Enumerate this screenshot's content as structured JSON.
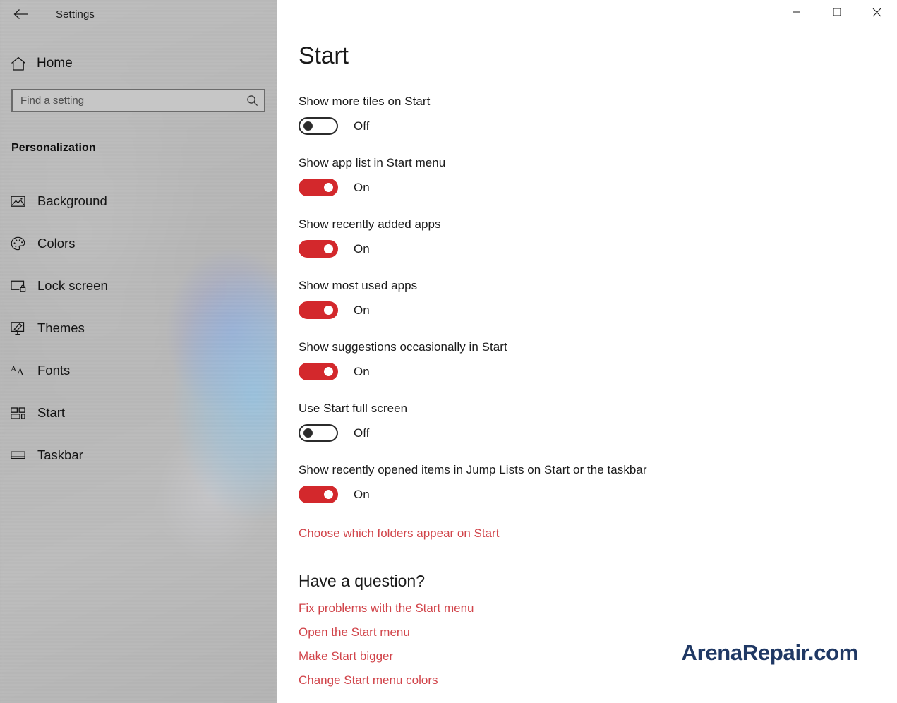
{
  "window": {
    "app_title": "Settings",
    "back_icon": "back-arrow-icon",
    "controls": {
      "minimize_label": "Minimize",
      "maximize_label": "Maximize",
      "close_label": "Close"
    }
  },
  "sidebar": {
    "home": {
      "label": "Home",
      "icon": "home-icon"
    },
    "search": {
      "placeholder": "Find a setting",
      "value": "",
      "icon": "search-icon"
    },
    "section_heading": "Personalization",
    "items": [
      {
        "label": "Background",
        "icon": "image-icon",
        "selected": false
      },
      {
        "label": "Colors",
        "icon": "palette-icon",
        "selected": false
      },
      {
        "label": "Lock screen",
        "icon": "lock-screen-icon",
        "selected": false
      },
      {
        "label": "Themes",
        "icon": "themes-icon",
        "selected": false
      },
      {
        "label": "Fonts",
        "icon": "fonts-icon",
        "selected": false
      },
      {
        "label": "Start",
        "icon": "start-tiles-icon",
        "selected": true
      },
      {
        "label": "Taskbar",
        "icon": "taskbar-icon",
        "selected": false
      }
    ]
  },
  "main": {
    "page_title": "Start",
    "settings": [
      {
        "label": "Show more tiles on Start",
        "state": "Off",
        "on": false
      },
      {
        "label": "Show app list in Start menu",
        "state": "On",
        "on": true
      },
      {
        "label": "Show recently added apps",
        "state": "On",
        "on": true
      },
      {
        "label": "Show most used apps",
        "state": "On",
        "on": true
      },
      {
        "label": "Show suggestions occasionally in Start",
        "state": "On",
        "on": true
      },
      {
        "label": "Use Start full screen",
        "state": "Off",
        "on": false
      },
      {
        "label": "Show recently opened items in Jump Lists on Start or the taskbar",
        "state": "On",
        "on": true
      }
    ],
    "folders_link": "Choose which folders appear on Start",
    "help": {
      "title": "Have a question?",
      "links": [
        "Fix problems with the Start menu",
        "Open the Start menu",
        "Make Start bigger",
        "Change Start menu colors"
      ]
    }
  },
  "watermark": {
    "text": "ArenaRepair.com"
  },
  "colors": {
    "accent_toggle": "#d3282c",
    "accent_link": "#d1444a",
    "watermark": "#1f3864",
    "sidebar_base": "#b8b8b8",
    "main_bg": "#ffffff"
  }
}
